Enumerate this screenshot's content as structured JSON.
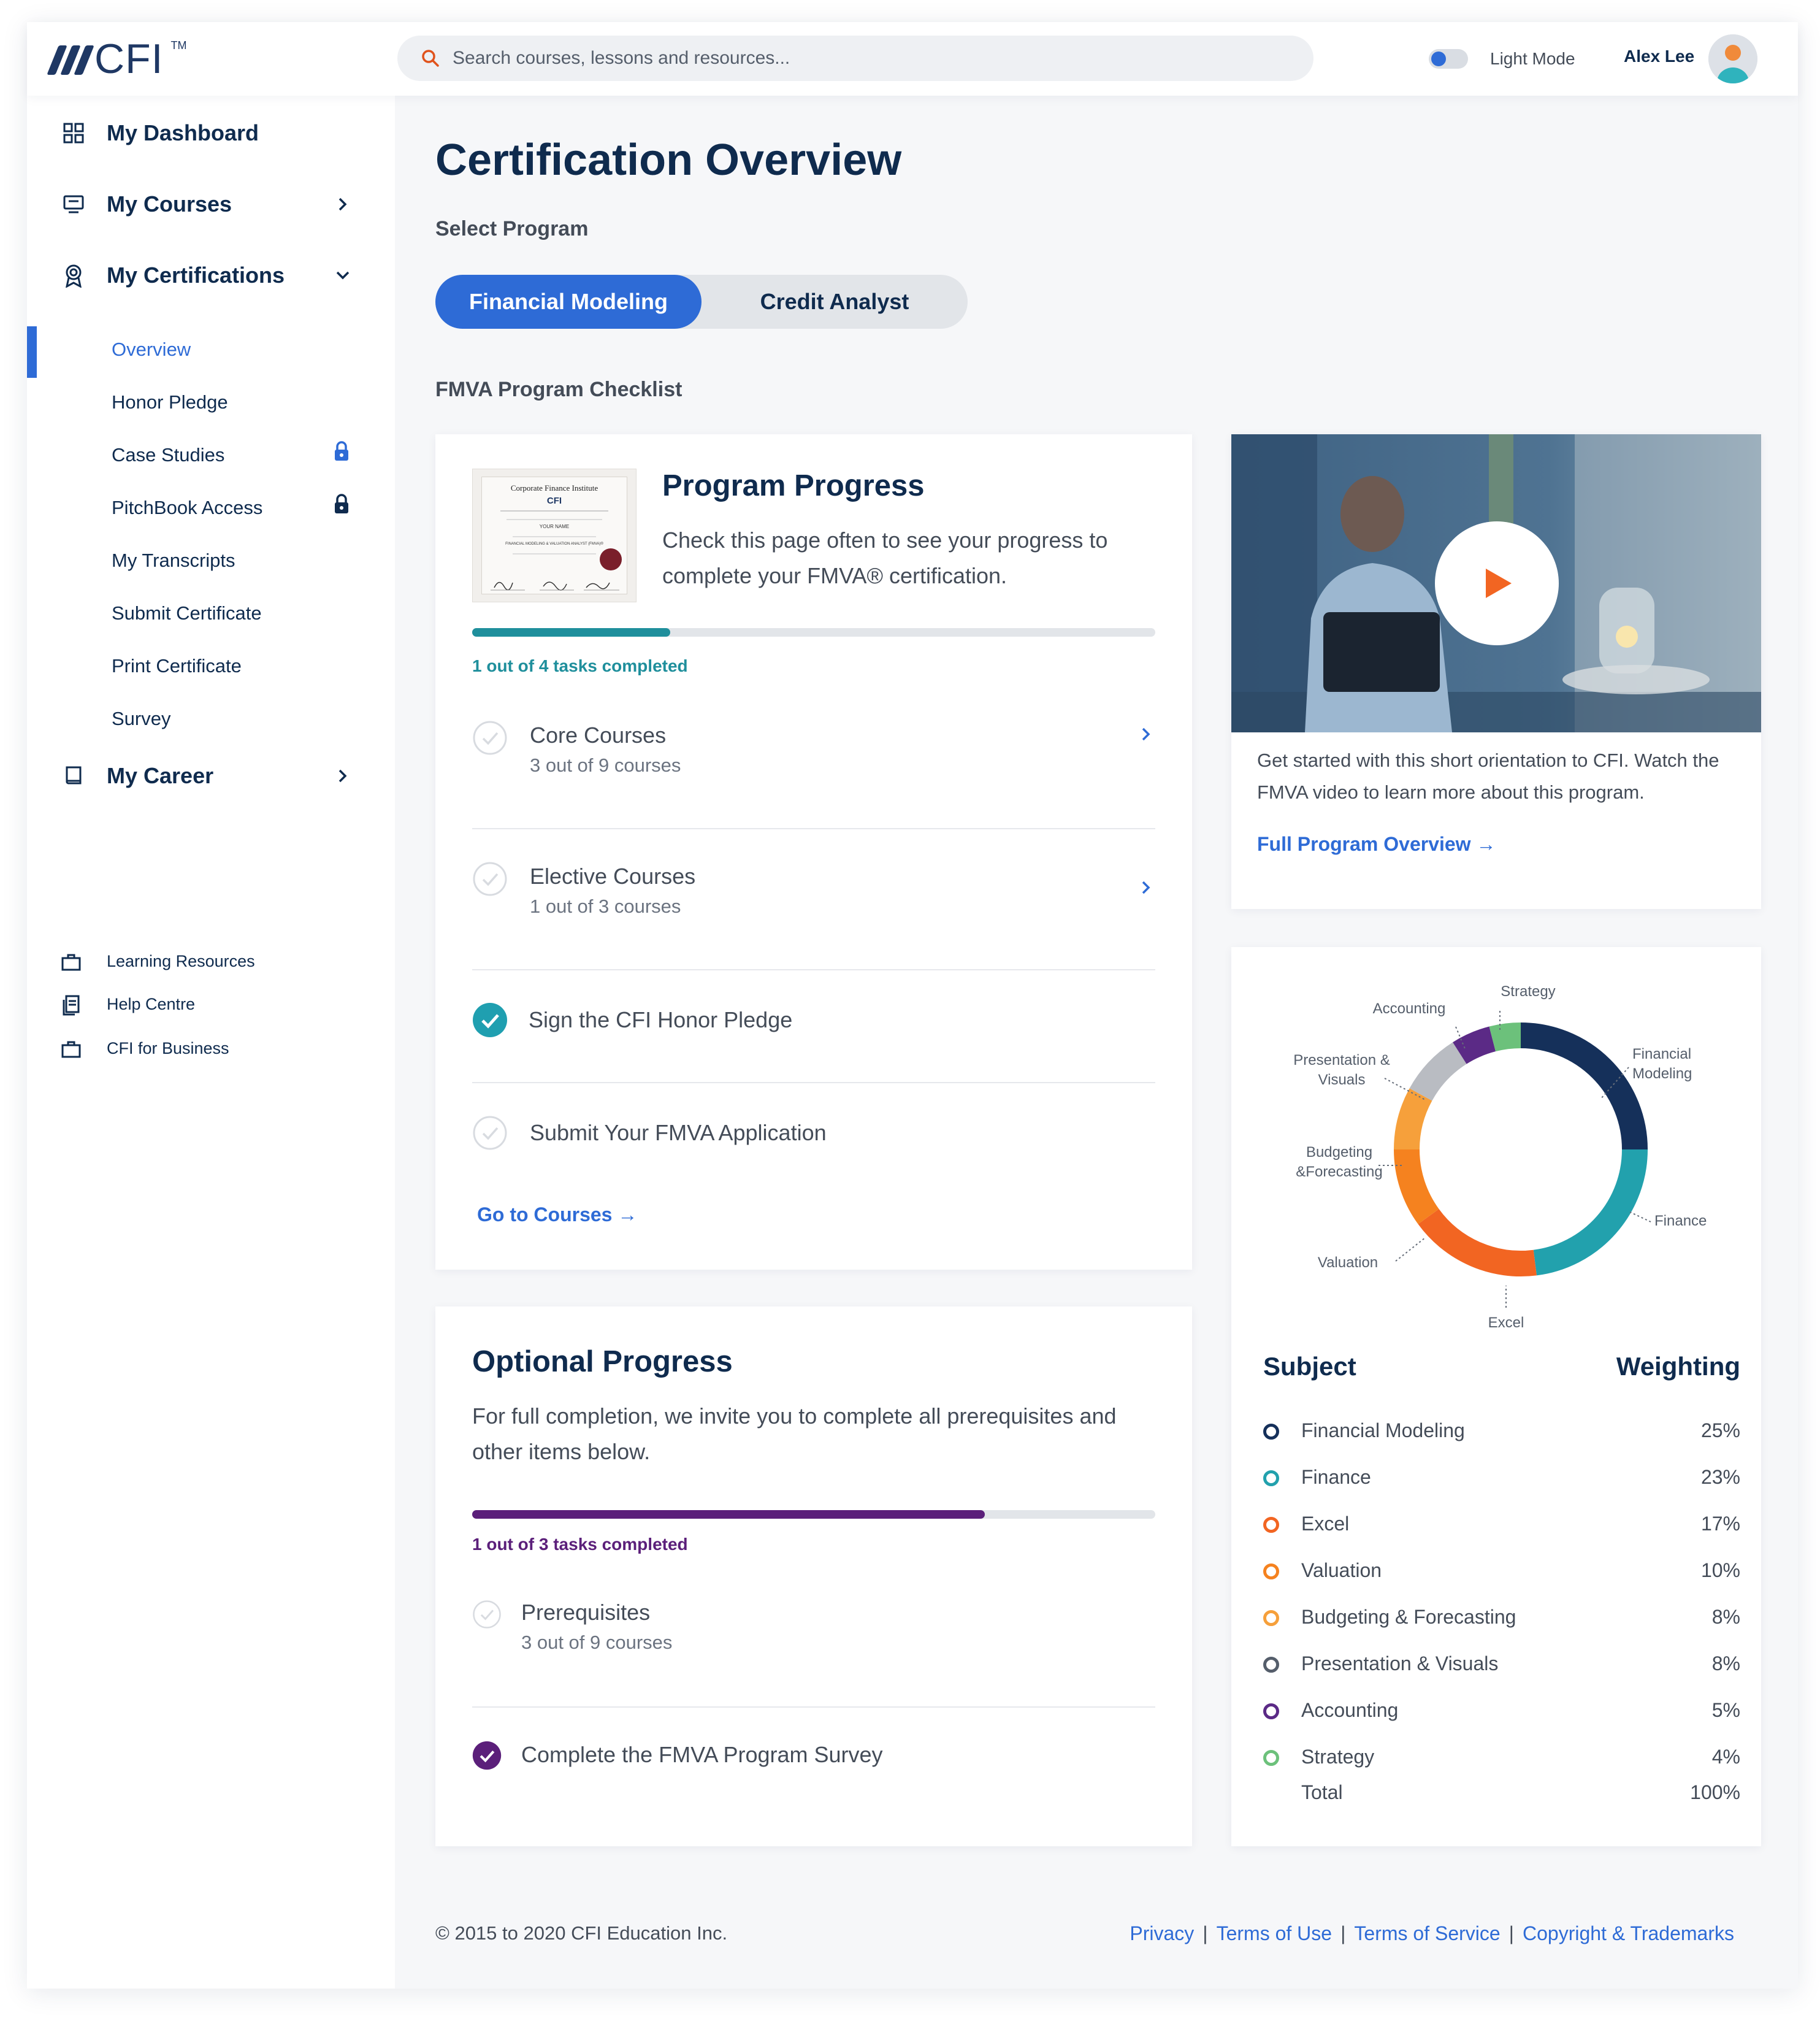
{
  "header": {
    "logo_text": "CFI",
    "logo_tm": "TM",
    "search_placeholder": "Search courses, lessons and resources...",
    "mode_label": "Light Mode",
    "user_name": "Alex Lee"
  },
  "sidebar": {
    "dashboard": "My Dashboard",
    "courses": "My Courses",
    "certifications": "My Certifications",
    "cert_items": [
      {
        "label": "Overview",
        "active": true
      },
      {
        "label": "Honor Pledge"
      },
      {
        "label": "Case Studies",
        "locked": true
      },
      {
        "label": "PitchBook Access",
        "locked": true
      },
      {
        "label": "My Transcripts"
      },
      {
        "label": "Submit Certificate"
      },
      {
        "label": "Print Certificate"
      },
      {
        "label": "Survey"
      }
    ],
    "career": "My Career",
    "footer_links": [
      "Learning Resources",
      "Help Centre",
      "CFI for Business"
    ]
  },
  "main": {
    "title": "Certification Overview",
    "select_label": "Select Program",
    "programs": [
      "Financial Modeling",
      "Credit Analyst"
    ],
    "checklist_label": "FMVA Program Checklist"
  },
  "program_progress": {
    "title": "Program Progress",
    "description": "Check this page often to see your progress to complete your FMVA® certification.",
    "progress_label": "1 out of 4 tasks completed",
    "progress_fraction": 0.29,
    "certificate": {
      "line1": "Corporate Finance Institute",
      "line2": "CFI",
      "line3": "YOUR NAME",
      "line4": "FINANCIAL MODELING & VALUATION ANALYST (FMVA)®"
    },
    "tasks": [
      {
        "title": "Core Courses",
        "sub": "3 out of 9 courses",
        "done": false
      },
      {
        "title": "Elective Courses",
        "sub": "1 out of 3 courses",
        "done": false
      },
      {
        "title": "Sign the CFI Honor Pledge",
        "done": true
      },
      {
        "title": "Submit Your FMVA Application",
        "done": false
      }
    ],
    "link": "Go to Courses →"
  },
  "optional_progress": {
    "title": "Optional Progress",
    "description": "For full completion, we invite you to complete all prerequisites and other items below.",
    "progress_label": "1 out of 3 tasks completed",
    "progress_fraction": 0.75,
    "tasks": [
      {
        "title": "Prerequisites",
        "sub": "3 out of 9 courses",
        "done": false
      },
      {
        "title": "Complete the FMVA Program Survey",
        "done": true
      }
    ]
  },
  "video_card": {
    "caption": "Get started with this short orientation to CFI. Watch the FMVA video to learn more about this program.",
    "link": "Full Program Overview →"
  },
  "weighting": {
    "subject_header": "Subject",
    "weight_header": "Weighting",
    "total_label": "Total",
    "total_value": "100%",
    "rows": [
      {
        "name": "Financial Modeling",
        "value": "25%",
        "color": "#15305a"
      },
      {
        "name": "Finance",
        "value": "23%",
        "color": "#22a1ad"
      },
      {
        "name": "Excel",
        "value": "17%",
        "color": "#f26522"
      },
      {
        "name": "Valuation",
        "value": "10%",
        "color": "#f5821f"
      },
      {
        "name": "Budgeting & Forecasting",
        "value": "8%",
        "color": "#f6a03b"
      },
      {
        "name": "Presentation & Visuals",
        "value": "8%",
        "color": "#b9bcc2"
      },
      {
        "name": "Accounting",
        "value": "5%",
        "color": "#5b2a86"
      },
      {
        "name": "Strategy",
        "value": "4%",
        "color": "#6cc17b"
      }
    ],
    "donut_labels": [
      "Strategy",
      "Accounting",
      "Presentation &",
      "Visuals",
      "Financial",
      "Modeling",
      "Budgeting",
      "&Forecasting",
      "Finance",
      "Valuation",
      "Excel"
    ]
  },
  "chart_data": {
    "type": "pie",
    "categories": [
      "Financial Modeling",
      "Finance",
      "Excel",
      "Valuation",
      "Budgeting & Forecasting",
      "Presentation & Visuals",
      "Accounting",
      "Strategy"
    ],
    "values": [
      25,
      23,
      17,
      10,
      8,
      8,
      5,
      4
    ],
    "colors": [
      "#15305a",
      "#22a1ad",
      "#f26522",
      "#f5821f",
      "#f6a03b",
      "#b9bcc2",
      "#5b2a86",
      "#6cc17b"
    ]
  },
  "footer": {
    "copyright": "© 2015 to 2020 CFI Education Inc.",
    "links": [
      "Privacy",
      "Terms of Use",
      "Terms of Service",
      "Copyright & Trademarks"
    ]
  }
}
